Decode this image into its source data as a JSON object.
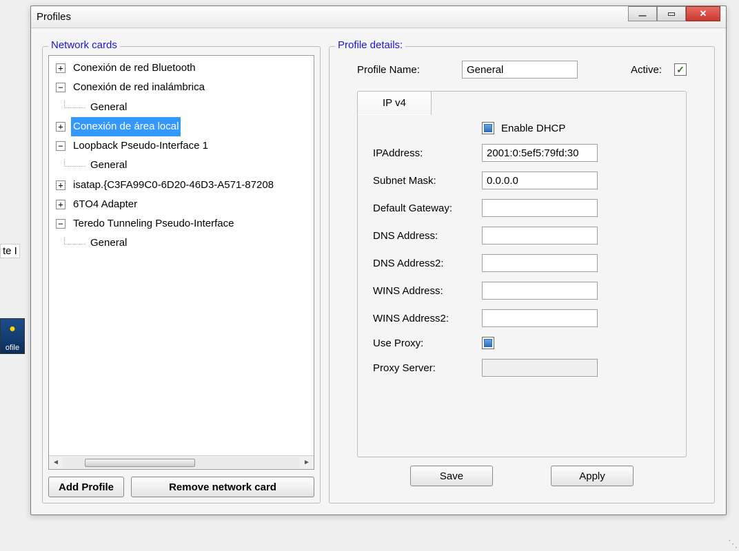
{
  "window": {
    "title": "Profiles"
  },
  "left": {
    "legend": "Network cards",
    "tree": [
      {
        "expand": "+",
        "label": "Conexión de red Bluetooth"
      },
      {
        "expand": "−",
        "label": "Conexión de red inalámbrica",
        "children": [
          {
            "label": "General"
          }
        ]
      },
      {
        "expand": "+",
        "label": "Conexión de área local",
        "selected": true
      },
      {
        "expand": "−",
        "label": "Loopback Pseudo-Interface 1",
        "children": [
          {
            "label": "General"
          }
        ]
      },
      {
        "expand": "+",
        "label": "isatap.{C3FA99C0-6D20-46D3-A571-87208"
      },
      {
        "expand": "+",
        "label": "6TO4 Adapter"
      },
      {
        "expand": "−",
        "label": "Teredo Tunneling Pseudo-Interface",
        "children": [
          {
            "label": "General"
          }
        ]
      }
    ],
    "buttons": {
      "add": "Add Profile",
      "remove": "Remove network card"
    }
  },
  "right": {
    "legend": "Profile details:",
    "profileNameLabel": "Profile Name:",
    "profileName": "General",
    "activeLabel": "Active:",
    "tab": "IP v4",
    "dhcpLabel": "Enable DHCP",
    "fields": {
      "ip": {
        "label": "IPAddress:",
        "value": "2001:0:5ef5:79fd:30"
      },
      "mask": {
        "label": "Subnet Mask:",
        "value": "0.0.0.0"
      },
      "gw": {
        "label": "Default Gateway:",
        "value": ""
      },
      "dns": {
        "label": "DNS Address:",
        "value": ""
      },
      "dns2": {
        "label": "DNS Address2:",
        "value": ""
      },
      "wins": {
        "label": "WINS Address:",
        "value": ""
      },
      "wins2": {
        "label": "WINS Address2:",
        "value": ""
      },
      "useProxy": {
        "label": "Use Proxy:"
      },
      "proxy": {
        "label": "Proxy Server:",
        "value": ""
      }
    },
    "buttons": {
      "save": "Save",
      "apply": "Apply"
    }
  },
  "bg": {
    "text": "te I",
    "iconLabel": "ofile"
  }
}
